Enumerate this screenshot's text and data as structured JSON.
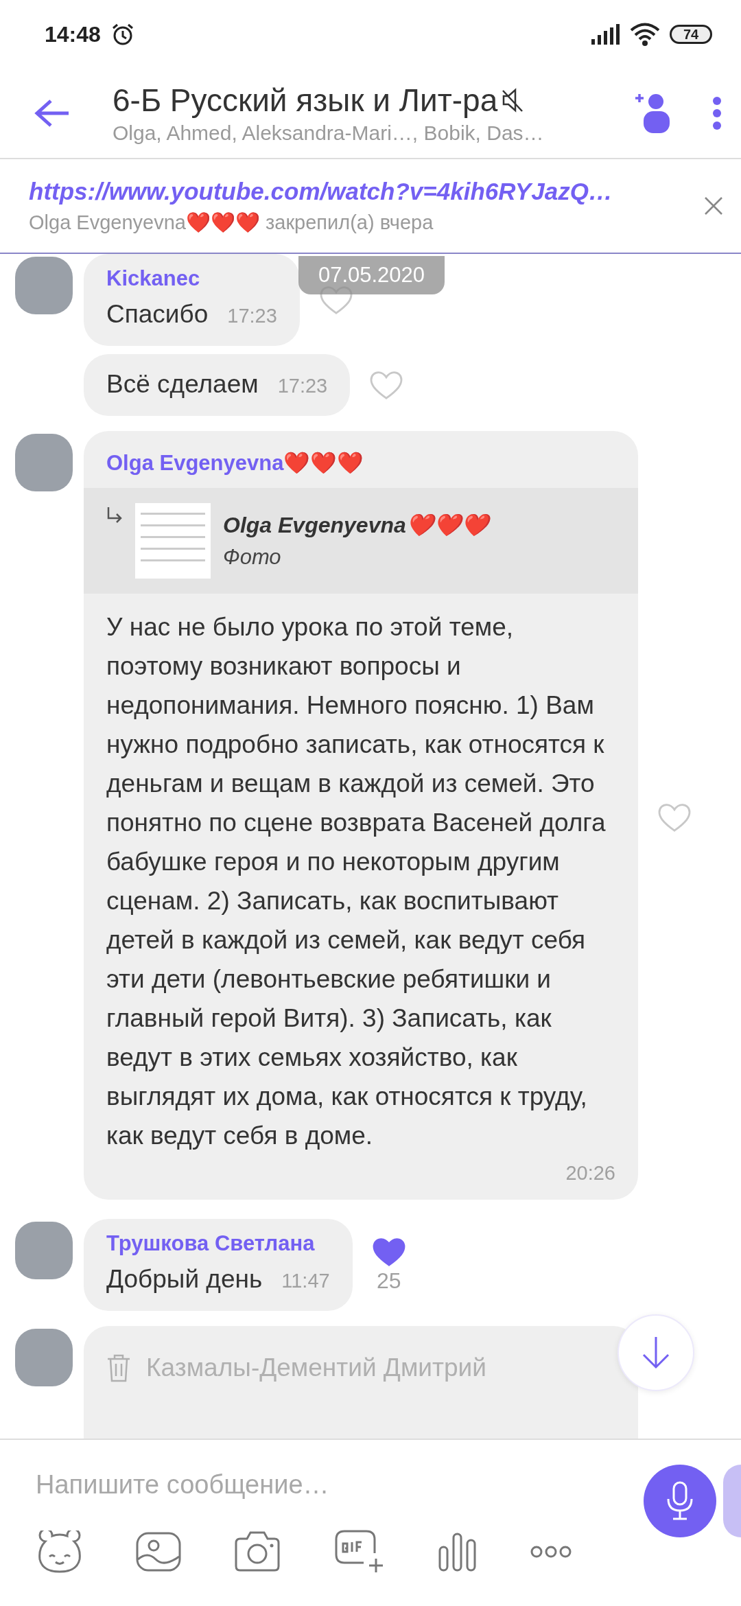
{
  "status_bar": {
    "time": "14:48",
    "battery": "74"
  },
  "header": {
    "title": "6-Б Русский язык и Лит-ра",
    "muted": true,
    "members": "Olga, Ahmed, Aleksandra-Mari…, Bobik, Das…"
  },
  "pinned": {
    "link": "https://www.youtube.com/watch?v=4kih6RYJazQ…",
    "note": "Olga Evgenyevna❤️❤️❤️ закрепил(а) вчера"
  },
  "date_chip": "07.05.2020",
  "messages": [
    {
      "kind": "group",
      "sender": "Kickanec",
      "bubbles": [
        {
          "text": "Спасибо",
          "time": "17:23",
          "liked": false
        },
        {
          "text": "Всё сделаем",
          "time": "17:23",
          "liked": false
        }
      ]
    },
    {
      "kind": "group",
      "sender": "Olga Evgenyevna❤️❤️❤️",
      "reply": {
        "author": "Olga Evgenyevna❤️❤️❤️",
        "text": "Фото"
      },
      "bubbles": [
        {
          "text": "У нас не было урока по этой теме, поэтому возникают вопросы и недопонимания. Немного поясню. 1) Вам нужно подробно записать, как относятся к деньгам и вещам в каждой из семей. Это понятно по сцене возврата Васеней долга бабушке героя и по некоторым другим сценам. 2) Записать, как воспитывают детей в каждой из семей, как ведут себя эти дети (левонтьевские ребятишки и главный герой Витя). 3) Записать, как ведут в этих семьях хозяйство, как выглядят их дома, как относятся к труду, как ведут себя в доме.",
          "time": "20:26",
          "liked": false
        }
      ]
    },
    {
      "kind": "group",
      "sender": "Трушкова Светлана",
      "bubbles": [
        {
          "text": "Добрый день",
          "time": "11:47",
          "liked": true,
          "likes": "25"
        }
      ]
    },
    {
      "kind": "deleted",
      "text": "Казмалы-Дементий Дмитрий"
    }
  ],
  "composer": {
    "placeholder": "Напишите сообщение…"
  }
}
